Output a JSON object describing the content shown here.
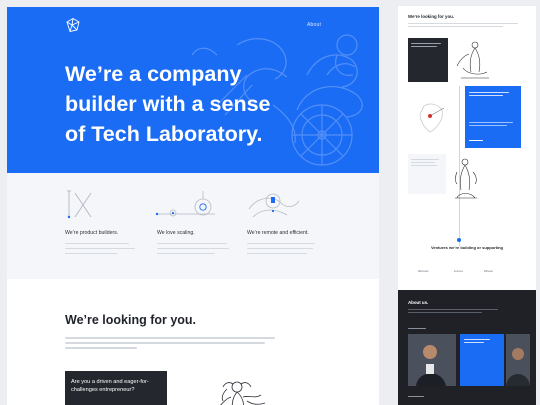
{
  "left": {
    "nav": {
      "about_label": "About"
    },
    "hero": {
      "title_lines": [
        "We’re a company",
        "builder with a sense",
        "of Tech Laboratory."
      ]
    },
    "features": [
      {
        "title": "We’re product builders.",
        "icon": "pencil-ruler-icon"
      },
      {
        "title": "We love scaling.",
        "icon": "scaling-icon"
      },
      {
        "title": "We’re remote and efficient.",
        "icon": "location-pin-icon"
      }
    ],
    "looking": {
      "title": "We’re looking for you.",
      "card_text": "Are you a driven and eager-for-challenges entrepreneur?"
    }
  },
  "right": {
    "looking_title": "We’re looking for you.",
    "ventures_title": "Ventures we’re building or supporting",
    "venture_logos": [
      "fabricator",
      "kosmos",
      "liftbeam"
    ],
    "about_title": "About us."
  },
  "colors": {
    "brand_blue": "#1a6cf5",
    "dark": "#25272e"
  }
}
